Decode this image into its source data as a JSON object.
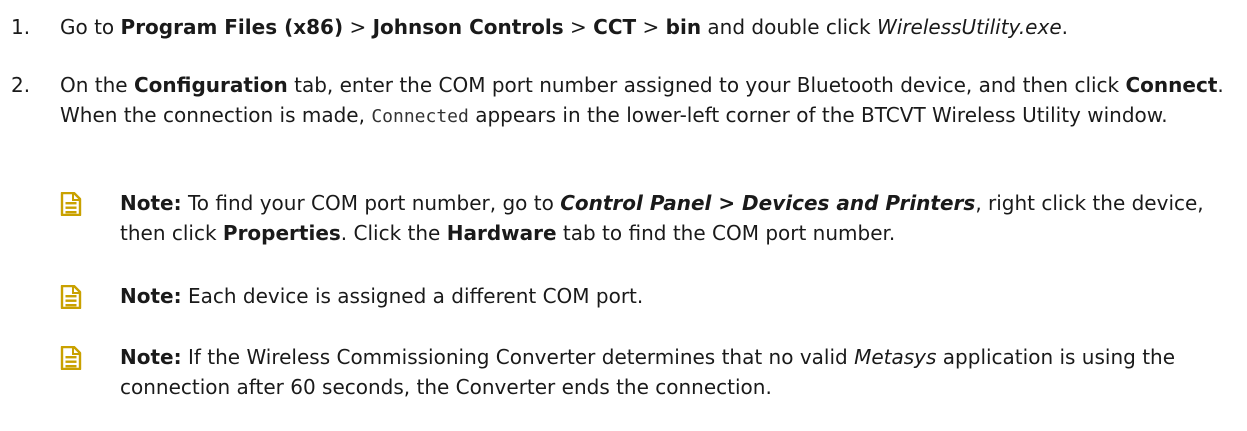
{
  "steps": [
    {
      "number": "1.",
      "parts": {
        "t1": "Go to ",
        "b1": "Program Files (x86)",
        "t2": " > ",
        "b2": "Johnson Controls",
        "t3": " > ",
        "b3": "CCT",
        "t4": " > ",
        "b4": "bin",
        "t5": " and double click ",
        "i1": "WirelessUtility.exe",
        "t6": "."
      }
    },
    {
      "number": "2.",
      "parts": {
        "t1": "On the ",
        "b1": "Configuration",
        "t2": " tab, enter the COM port number assigned to your Bluetooth device, and then click ",
        "b2": "Connect",
        "t3": ". When the connection is made, ",
        "m1": "Connected",
        "t4": " appears in the lower-left corner of the BTCVT Wireless Utility window."
      }
    }
  ],
  "notes": [
    {
      "label": "Note:",
      "t1": " To find your COM port number, go to ",
      "bi1": "Control Panel > Devices and Printers",
      "t2": ", right click the device, then click ",
      "b1": "Properties",
      "t3": ". Click the ",
      "b2": "Hardware",
      "t4": " tab to find the COM port number."
    },
    {
      "label": "Note:",
      "t1": " Each device is assigned a different COM port."
    },
    {
      "label": "Note:",
      "t1": " If the Wireless Commissioning Converter determines that no valid ",
      "i1": "Metasys",
      "t2": " application is using the connection after 60 seconds, the Converter ends the connection."
    }
  ],
  "icons": {
    "note": "note-document-icon",
    "color": "#c9a100"
  }
}
